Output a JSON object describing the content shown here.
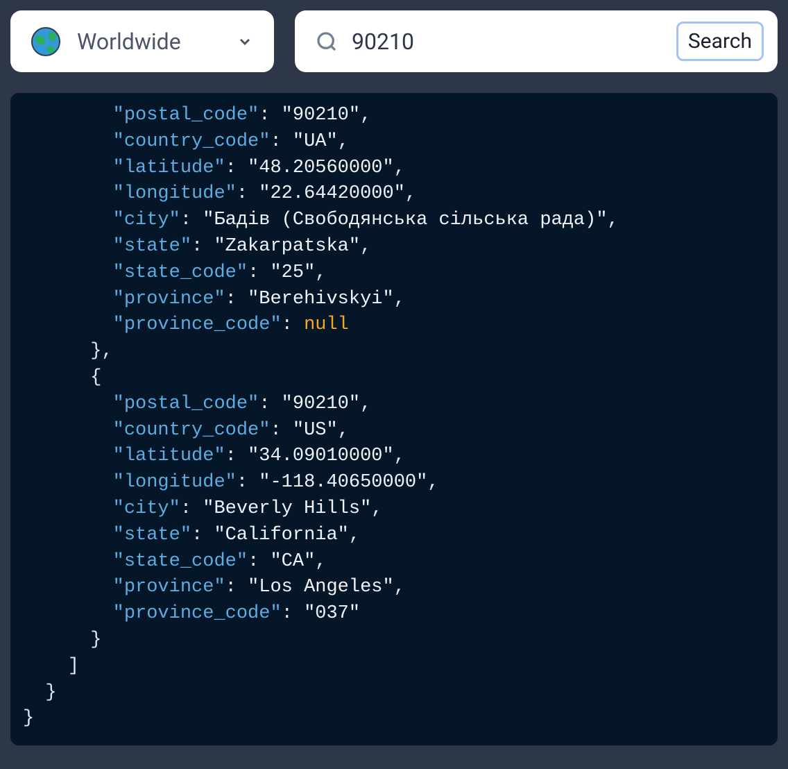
{
  "region_selector": {
    "label": "Worldwide"
  },
  "search": {
    "value": "90210",
    "button_label": "Search"
  },
  "json_response": {
    "results": [
      {
        "postal_code": "90210",
        "country_code": "UA",
        "latitude": "48.20560000",
        "longitude": "22.64420000",
        "city": "Бадів (Свободянська сільська рада)",
        "state": "Zakarpatska",
        "state_code": "25",
        "province": "Berehivskyi",
        "province_code": null
      },
      {
        "postal_code": "90210",
        "country_code": "US",
        "latitude": "34.09010000",
        "longitude": "-118.40650000",
        "city": "Beverly Hills",
        "state": "California",
        "state_code": "CA",
        "province": "Los Angeles",
        "province_code": "037"
      }
    ]
  }
}
